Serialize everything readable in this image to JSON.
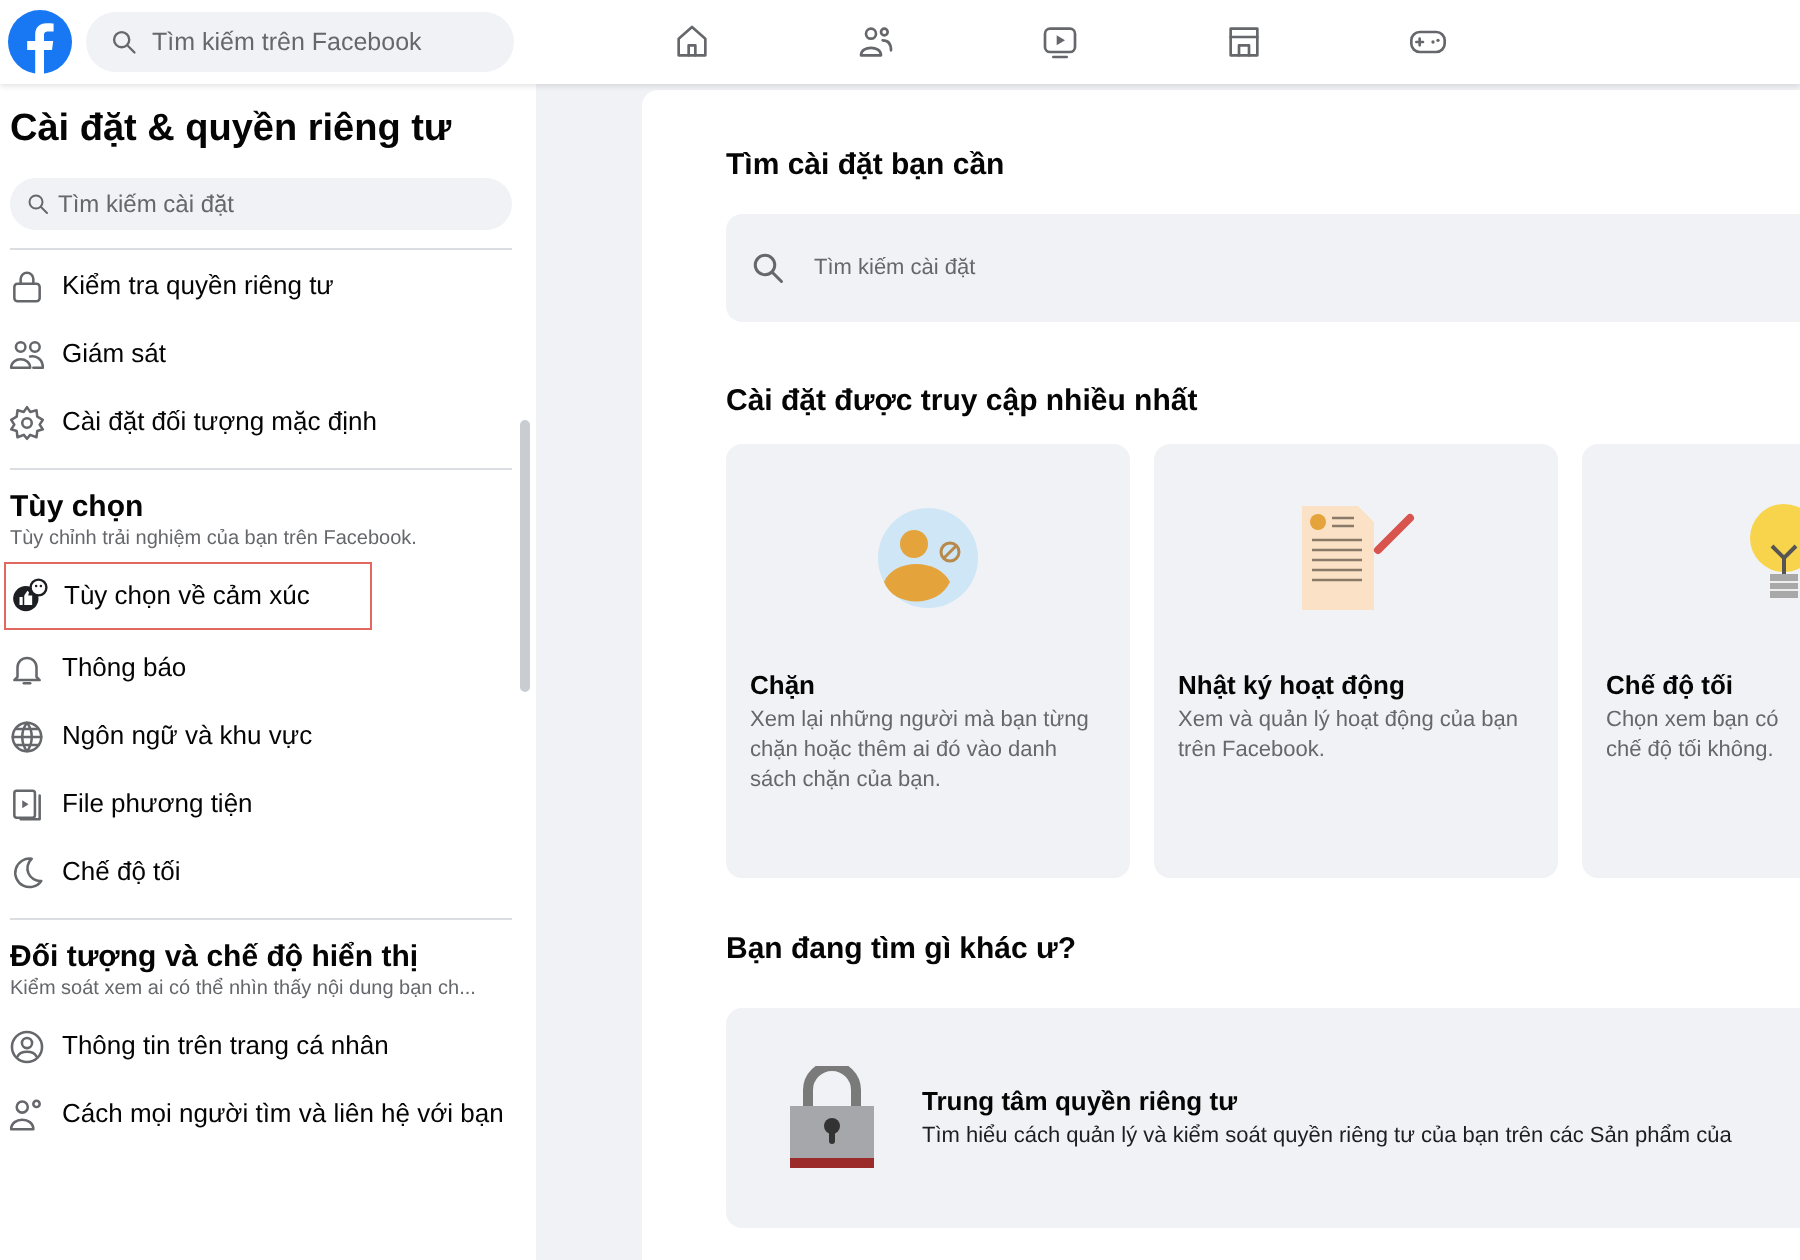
{
  "topbar": {
    "search": {
      "placeholder": "Tìm kiếm trên Facebook"
    },
    "nav": [
      {
        "selected": false
      },
      {
        "selected": false
      },
      {
        "selected": false
      },
      {
        "selected": false
      },
      {
        "selected": false
      }
    ]
  },
  "sidebar": {
    "title": "Cài đặt & quyền riêng tư",
    "search": {
      "placeholder": "Tìm kiếm cài đặt"
    },
    "sections": [
      {
        "items": [
          {
            "label": "Kiểm tra quyền riêng tư",
            "highlighted": false
          },
          {
            "label": "Giám sát",
            "highlighted": false
          },
          {
            "label": "Cài đặt đối tượng mặc định",
            "highlighted": false
          }
        ]
      },
      {
        "heading": "Tùy chọn",
        "description": "Tùy chỉnh trải nghiệm của bạn trên Facebook.",
        "items": [
          {
            "label": "Tùy chọn về cảm xúc",
            "highlighted": true
          },
          {
            "label": "Thông báo",
            "highlighted": false
          },
          {
            "label": "Ngôn ngữ và khu vực",
            "highlighted": false
          },
          {
            "label": "File phương tiện",
            "highlighted": false
          },
          {
            "label": "Chế độ tối",
            "highlighted": false
          }
        ]
      },
      {
        "heading": "Đối tượng và chế độ hiển thị",
        "description": "Kiểm soát xem ai có thể nhìn thấy nội dung bạn ch...",
        "items": [
          {
            "label": "Thông tin trên trang cá nhân",
            "highlighted": false
          },
          {
            "label": "Cách mọi người tìm và liên hệ với bạn",
            "highlighted": false
          }
        ]
      }
    ]
  },
  "main": {
    "search_heading": "Tìm cài đặt bạn cần",
    "search": {
      "placeholder": "Tìm kiếm cài đặt"
    },
    "frequent_heading": "Cài đặt được truy cập nhiều nhất",
    "cards": [
      {
        "title": "Chặn",
        "description": "Xem lại những người mà bạn từng chặn hoặc thêm ai đó vào danh sách chặn của bạn."
      },
      {
        "title": "Nhật ký hoạt động",
        "description": "Xem và quản lý hoạt động của bạn trên Facebook."
      },
      {
        "title": "Chế độ tối",
        "description": "Chọn xem bạn có\nchế độ tối không."
      }
    ],
    "other_heading": "Bạn đang tìm gì khác ư?",
    "privacy_center": {
      "title": "Trung tâm quyền riêng tư",
      "description": "Tìm hiểu cách quản lý và kiểm soát quyền riêng tư của bạn trên các Sản phẩm của"
    }
  }
}
